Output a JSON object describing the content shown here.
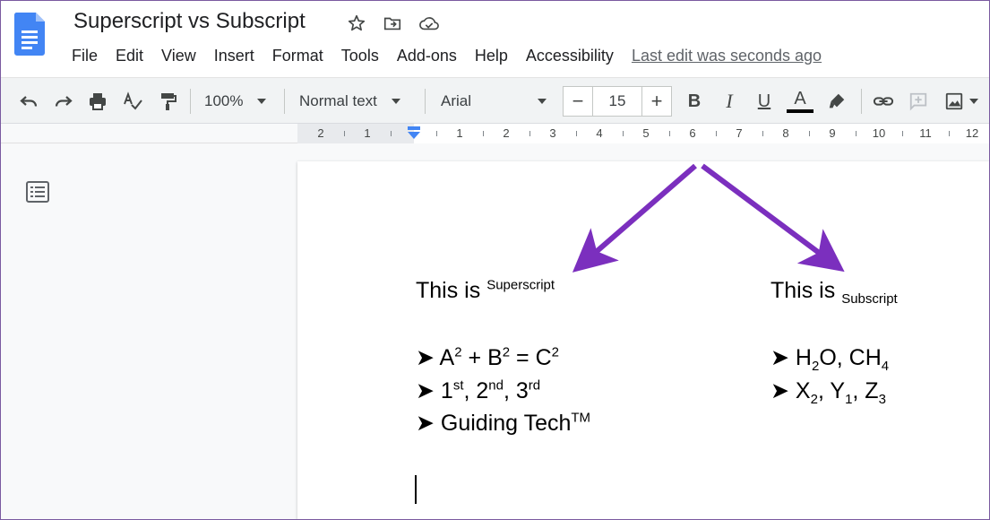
{
  "app": {
    "title": "Superscript vs Subscript",
    "last_edit": "Last edit was seconds ago"
  },
  "menu": [
    "File",
    "Edit",
    "View",
    "Insert",
    "Format",
    "Tools",
    "Add-ons",
    "Help",
    "Accessibility"
  ],
  "toolbar": {
    "zoom": "100%",
    "style": "Normal text",
    "font": "Arial",
    "font_size": "15",
    "minus": "−",
    "plus": "+",
    "bold": "B",
    "italic": "I",
    "underline": "U",
    "text_color_letter": "A"
  },
  "ruler": {
    "labels": [
      "2",
      "1",
      "1",
      "2",
      "3",
      "4",
      "5",
      "6",
      "7",
      "8",
      "9",
      "10",
      "11",
      "12"
    ]
  },
  "document": {
    "superscript_heading": {
      "prefix": "This is ",
      "script": "Superscript"
    },
    "subscript_heading": {
      "prefix": "This is ",
      "script": "Subscript"
    },
    "bullet_glyph": "➤",
    "sup1": {
      "a": "A",
      "a_exp": "2",
      "plus": " + ",
      "b": "B",
      "b_exp": "2",
      "eq": " = ",
      "c": "C",
      "c_exp": "2"
    },
    "sup2": {
      "n1": "1",
      "s1": "st",
      "n2": ", 2",
      "s2": "nd",
      "n3": ", 3",
      "s3": "rd"
    },
    "sup3": {
      "text": "Guiding Tech",
      "mark": "TM"
    },
    "sub1": {
      "h": "H",
      "h_sub": "2",
      "o": "O, CH",
      "ch_sub": "4"
    },
    "sub2": {
      "x": "X",
      "x_sub": "2",
      "y": ", Y",
      "y_sub": "1",
      "z": ", Z",
      "z_sub": "3"
    }
  },
  "colors": {
    "arrow": "#7b2fbe",
    "docs_blue": "#4285f4"
  }
}
